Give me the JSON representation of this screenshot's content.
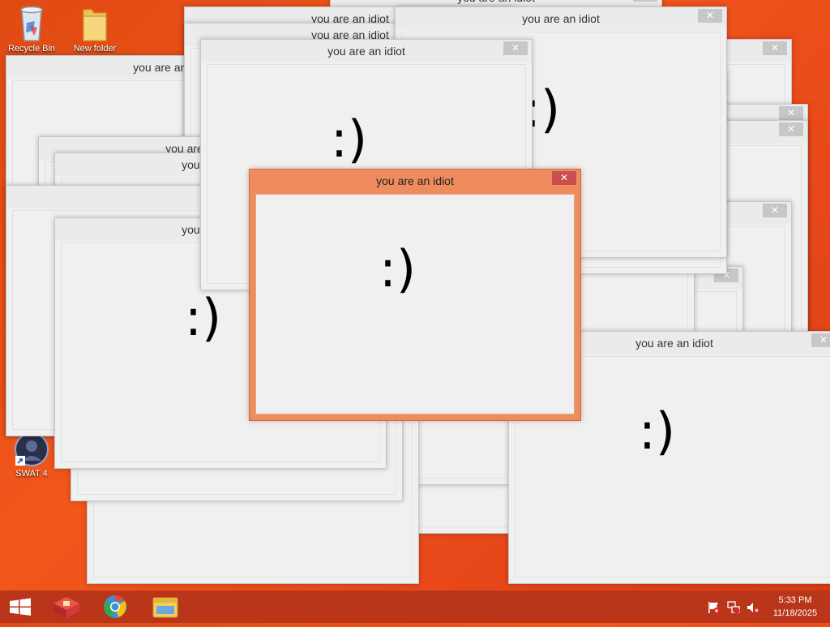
{
  "desktop": {
    "icons": [
      {
        "label": "Recycle Bin",
        "icon": "recycle-bin-icon"
      },
      {
        "label": "New folder",
        "icon": "folder-icon"
      },
      {
        "label": "SWAT 4",
        "icon": "swat4-shortcut-icon"
      }
    ]
  },
  "popup": {
    "title": "you are an idiot",
    "face": ":)",
    "close_glyph": "✕"
  },
  "taskbar": {
    "buttons": [
      {
        "icon": "windows-start-icon"
      },
      {
        "icon": "winrar-icon"
      },
      {
        "icon": "chrome-icon"
      },
      {
        "icon": "file-explorer-icon"
      }
    ]
  },
  "tray": {
    "time": "5:33 PM",
    "date": "11/18/2025",
    "icons": [
      "action-center-flag-icon",
      "network-icon",
      "volume-muted-icon"
    ]
  },
  "colors": {
    "desktop_bg": "#ec4f17",
    "active_window": "#ee8c5e",
    "close_active": "#c94f4f",
    "taskbar": "#b9361a"
  }
}
